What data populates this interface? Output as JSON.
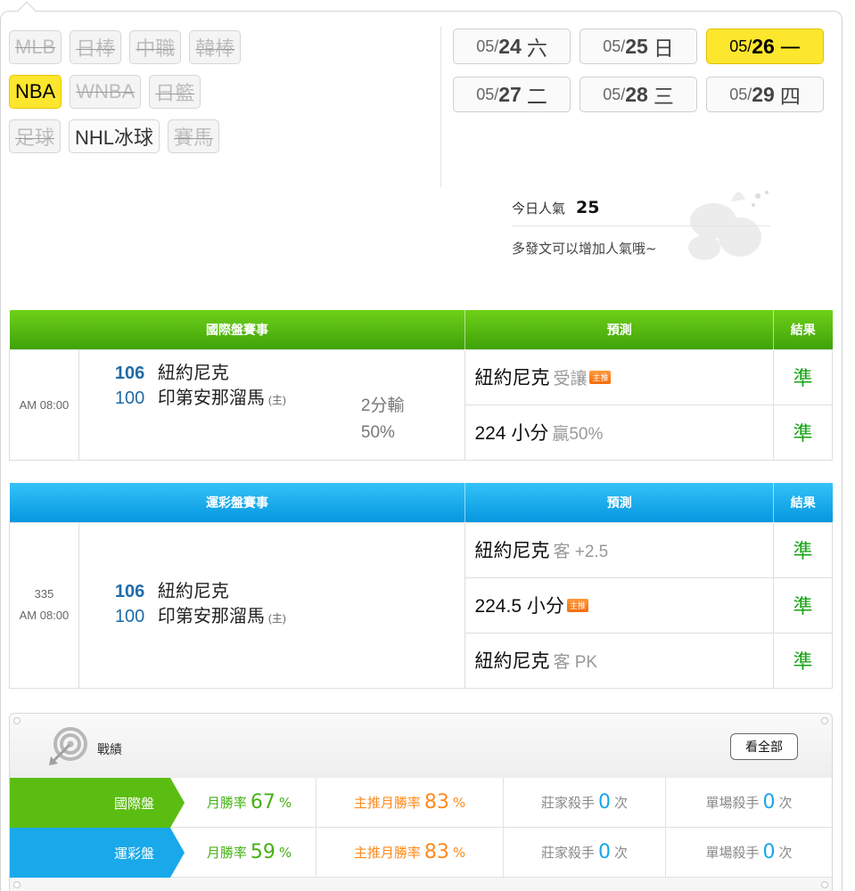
{
  "leagues": {
    "row1": [
      {
        "label": "MLB",
        "state": "disabled"
      },
      {
        "label": "日棒",
        "state": "disabled"
      },
      {
        "label": "中職",
        "state": "disabled"
      },
      {
        "label": "韓棒",
        "state": "disabled"
      }
    ],
    "row2": [
      {
        "label": "NBA",
        "state": "active"
      },
      {
        "label": "WNBA",
        "state": "disabled"
      },
      {
        "label": "日籃",
        "state": "disabled"
      }
    ],
    "row3": [
      {
        "label": "足球",
        "state": "disabled"
      },
      {
        "label": "NHL冰球",
        "state": "enabled"
      },
      {
        "label": "賽馬",
        "state": "disabled"
      }
    ]
  },
  "dates": [
    {
      "month": "05/",
      "day": "24",
      "weekday": "六",
      "active": false
    },
    {
      "month": "05/",
      "day": "25",
      "weekday": "日",
      "active": false
    },
    {
      "month": "05/",
      "day": "26",
      "weekday": "一",
      "active": true
    },
    {
      "month": "05/",
      "day": "27",
      "weekday": "二",
      "active": false
    },
    {
      "month": "05/",
      "day": "28",
      "weekday": "三",
      "active": false
    },
    {
      "month": "05/",
      "day": "29",
      "weekday": "四",
      "active": false
    }
  ],
  "popularity": {
    "label": "今日人氣",
    "value": "25",
    "hint": "多發文可以增加人氣哦~"
  },
  "intl": {
    "header_match": "國際盤賽事",
    "header_pred": "預測",
    "header_result": "結果",
    "time": "AM 08:00",
    "away_score": "106",
    "away_team": "紐約尼克",
    "home_score": "100",
    "home_team": "印第安那溜馬",
    "home_mark": "(主)",
    "spread_result": "2分輸",
    "spread_pct": "50%",
    "predictions": [
      {
        "main": "紐約尼克",
        "sub": "受讓",
        "badge": "主推",
        "result": "準"
      },
      {
        "main": "224 小分",
        "sub": "贏50%",
        "badge": "",
        "result": "準"
      }
    ]
  },
  "sports": {
    "header_match": "運彩盤賽事",
    "header_pred": "預測",
    "header_result": "結果",
    "game_no": "335",
    "time": "AM 08:00",
    "away_score": "106",
    "away_team": "紐約尼克",
    "home_score": "100",
    "home_team": "印第安那溜馬",
    "home_mark": "(主)",
    "predictions": [
      {
        "main": "紐約尼克",
        "sub": "客 +2.5",
        "badge": "",
        "result": "準"
      },
      {
        "main": "224.5 小分",
        "sub": "",
        "badge": "主推",
        "result": "準"
      },
      {
        "main": "紐約尼克",
        "sub": "客 PK",
        "badge": "",
        "result": "準"
      }
    ]
  },
  "record": {
    "title": "戰績",
    "view_all": "看全部",
    "rows": [
      {
        "label": "國際盤",
        "month_rate_label": "月勝率",
        "month_rate": "67",
        "pick_rate_label": "主推月勝率",
        "pick_rate": "83",
        "pct": "%",
        "banker_label": "莊家殺手",
        "banker": "0",
        "single_label": "單場殺手",
        "single": "0",
        "times": "次"
      },
      {
        "label": "運彩盤",
        "month_rate_label": "月勝率",
        "month_rate": "59",
        "pick_rate_label": "主推月勝率",
        "pick_rate": "83",
        "pct": "%",
        "banker_label": "莊家殺手",
        "banker": "0",
        "single_label": "單場殺手",
        "single": "0",
        "times": "次"
      }
    ]
  },
  "colors": {
    "active_yellow": "#fde62e",
    "intl_green": "#4caf10",
    "sports_blue": "#0aa0e8",
    "result_green": "#17a316",
    "pick_orange": "#ff8a1a"
  }
}
